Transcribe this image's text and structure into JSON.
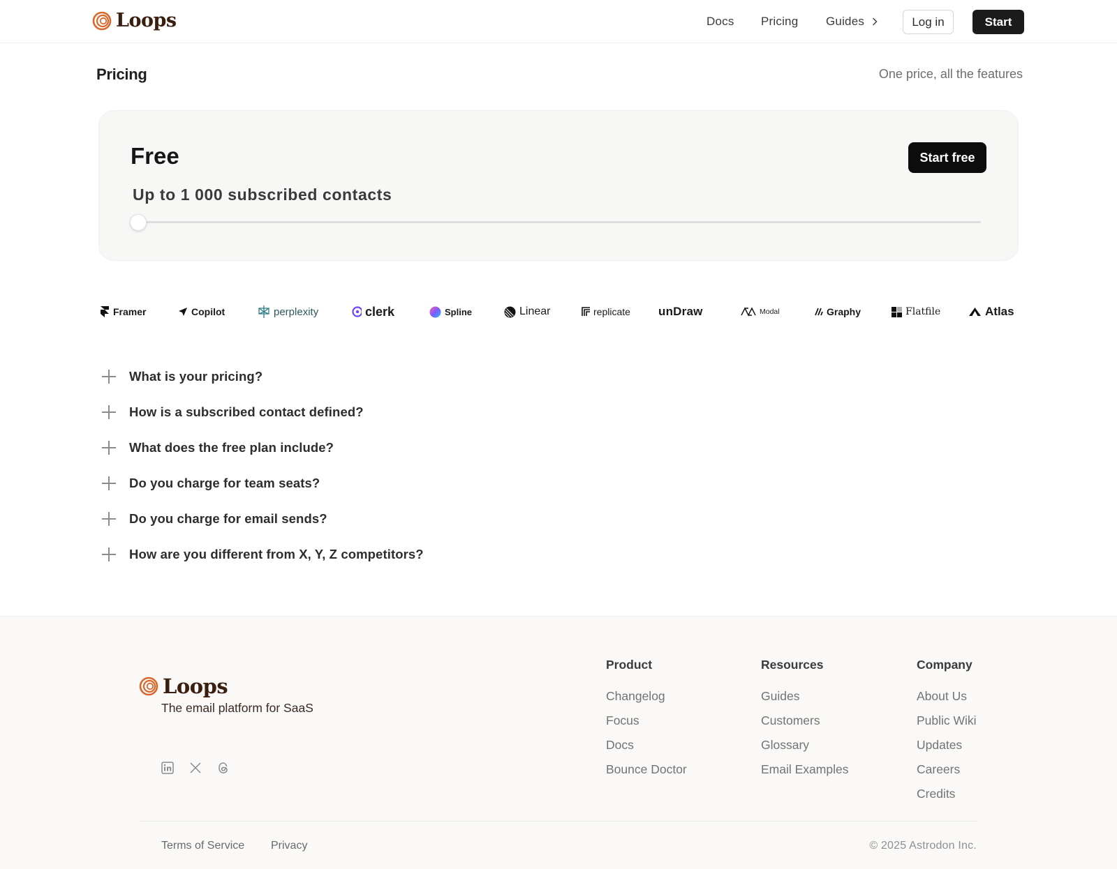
{
  "header": {
    "logo_text": "Loops",
    "nav": {
      "docs": "Docs",
      "pricing": "Pricing",
      "guides": "Guides"
    },
    "login_label": "Log in",
    "start_label": "Start"
  },
  "pricing": {
    "title": "Pricing",
    "subtitle": "One price, all the features"
  },
  "plan": {
    "name": "Free",
    "contacts_text": "Up to 1 000 subscribed contacts",
    "cta": "Start free",
    "slider_fraction": 0.0
  },
  "customer_logos": [
    "Framer",
    "Copilot",
    "perplexity",
    "clerk",
    "Spline",
    "Linear",
    "replicate",
    "unDraw",
    "Modal",
    "Graphy",
    "Flatfile",
    "Atlas"
  ],
  "faq": [
    "What is your pricing?",
    "How is a subscribed contact defined?",
    "What does the free plan include?",
    "Do you charge for team seats?",
    "Do you charge for email sends?",
    "How are you different from X, Y, Z competitors?"
  ],
  "footer": {
    "logo_text": "Loops",
    "tagline": "The email platform for SaaS",
    "socials": [
      "linkedin-icon",
      "x-icon",
      "threads-icon"
    ],
    "columns": [
      {
        "heading": "Product",
        "links": [
          "Changelog",
          "Focus",
          "Docs",
          "Bounce Doctor"
        ]
      },
      {
        "heading": "Resources",
        "links": [
          "Guides",
          "Customers",
          "Glossary",
          "Email Examples"
        ]
      },
      {
        "heading": "Company",
        "links": [
          "About Us",
          "Public Wiki",
          "Updates",
          "Careers",
          "Credits"
        ]
      }
    ],
    "legal": {
      "terms": "Terms of Service",
      "privacy": "Privacy"
    },
    "copyright": "© 2025 Astrodon Inc."
  },
  "colors": {
    "brand_orange": "#d9672a",
    "brand_brown": "#3a1e10",
    "button_dark": "#1b1b1b",
    "card_bg": "#f7f7f6",
    "footer_bg": "#faf9f8"
  }
}
